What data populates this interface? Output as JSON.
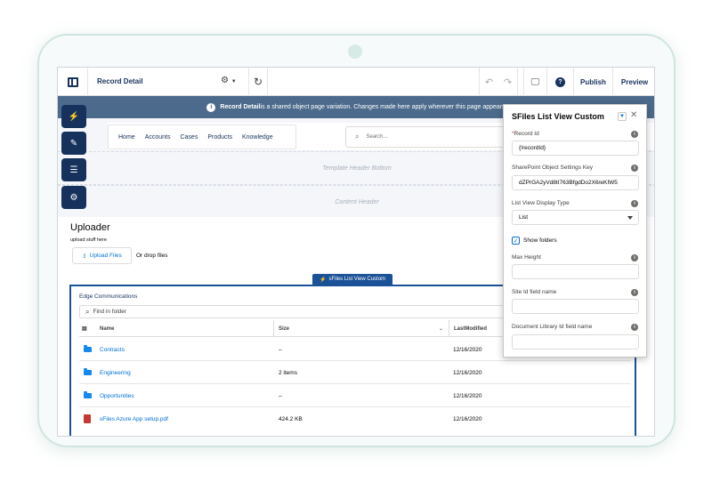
{
  "topbar": {
    "page_title": "Record Detail",
    "publish_label": "Publish",
    "preview_label": "Preview"
  },
  "infobar": {
    "strong": "Record Detail",
    "text": " is a shared object page variation. Changes made here apply wherever this page appears."
  },
  "nav": {
    "items": [
      "Home",
      "Accounts",
      "Cases",
      "Products",
      "Knowledge"
    ],
    "search_placeholder": "Search..."
  },
  "regions": {
    "template_header_bottom": "Template Header Bottom",
    "content_header": "Content Header"
  },
  "uploader": {
    "title": "Uploader",
    "subtitle": "upload stuff here",
    "upload_label": "Upload Files",
    "drop_label": "Or drop files"
  },
  "component": {
    "tag": "sFiles List View Custom",
    "folder": "Edge Communications",
    "find_placeholder": "Find in folder",
    "columns": {
      "name": "Name",
      "size": "Size",
      "modified": "LastModified"
    },
    "rows": [
      {
        "name": "Contracts",
        "size": "–",
        "modified": "12/16/2020",
        "icon": "folder-icon"
      },
      {
        "name": "Engineering",
        "size": "2 items",
        "modified": "12/16/2020",
        "icon": "folder-icon"
      },
      {
        "name": "Opportunities",
        "size": "–",
        "modified": "12/16/2020",
        "icon": "folder-icon"
      },
      {
        "name": "sFiles Azure App setup.pdf",
        "size": "424.2 KB",
        "modified": "12/16/2020",
        "icon": "pdf-icon"
      }
    ]
  },
  "panel": {
    "title": "SFiles List View Custom",
    "record_id_label": "Record Id",
    "record_id_value": "{!recordId}",
    "sp_settings_label": "SharePoint Object Settings Key",
    "sp_settings_value": "dZPrGA2yVd8tI763BfgdDo2X6/eKIW5",
    "display_type_label": "List View Display Type",
    "display_type_value": "List",
    "show_folders_label": "Show folders",
    "show_folders_checked": true,
    "max_height_label": "Max Height",
    "site_id_label": "Site Id field name",
    "doc_lib_label": "Document Library Id field name"
  },
  "colors": {
    "brand_navy": "#16325c",
    "info_bar": "#4c6b8c",
    "component_border": "#1b5297",
    "link": "#0070d2"
  }
}
